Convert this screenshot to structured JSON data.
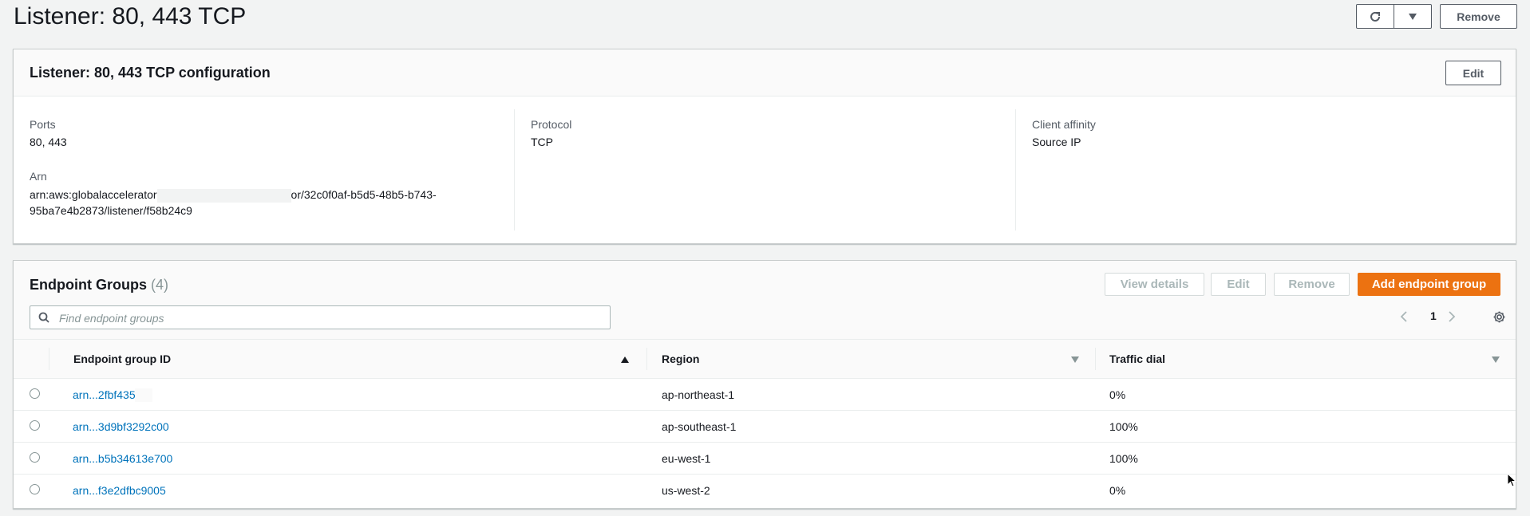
{
  "page": {
    "title": "Listener: 80, 443 TCP"
  },
  "toolbar": {
    "remove_label": "Remove"
  },
  "config": {
    "title": "Listener: 80, 443 TCP configuration",
    "edit_label": "Edit",
    "ports_label": "Ports",
    "ports_value": "80, 443",
    "arn_label": "Arn",
    "arn_prefix": "arn:aws:globalaccelerator",
    "arn_suffix": "or/32c0f0af-b5d5-48b5-b743-",
    "arn_line2": "95ba7e4b2873/listener/f58b24c9",
    "protocol_label": "Protocol",
    "protocol_value": "TCP",
    "affinity_label": "Client affinity",
    "affinity_value": "Source IP"
  },
  "groups": {
    "title": "Endpoint Groups",
    "count": "(4)",
    "view_details_label": "View details",
    "edit_label": "Edit",
    "remove_label": "Remove",
    "add_label": "Add endpoint group",
    "search_placeholder": "Find endpoint groups",
    "page_number": "1",
    "columns": [
      "Endpoint group ID",
      "Region",
      "Traffic dial"
    ],
    "rows": [
      {
        "id": "arn...2fbf4354",
        "region": "ap-northeast-1",
        "dial": "0%"
      },
      {
        "id": "arn...3d9bf3292c00",
        "region": "ap-southeast-1",
        "dial": "100%"
      },
      {
        "id": "arn...b5b34613e700",
        "region": "eu-west-1",
        "dial": "100%"
      },
      {
        "id": "arn...f3e2dfbc9005",
        "region": "us-west-2",
        "dial": "0%"
      }
    ]
  }
}
